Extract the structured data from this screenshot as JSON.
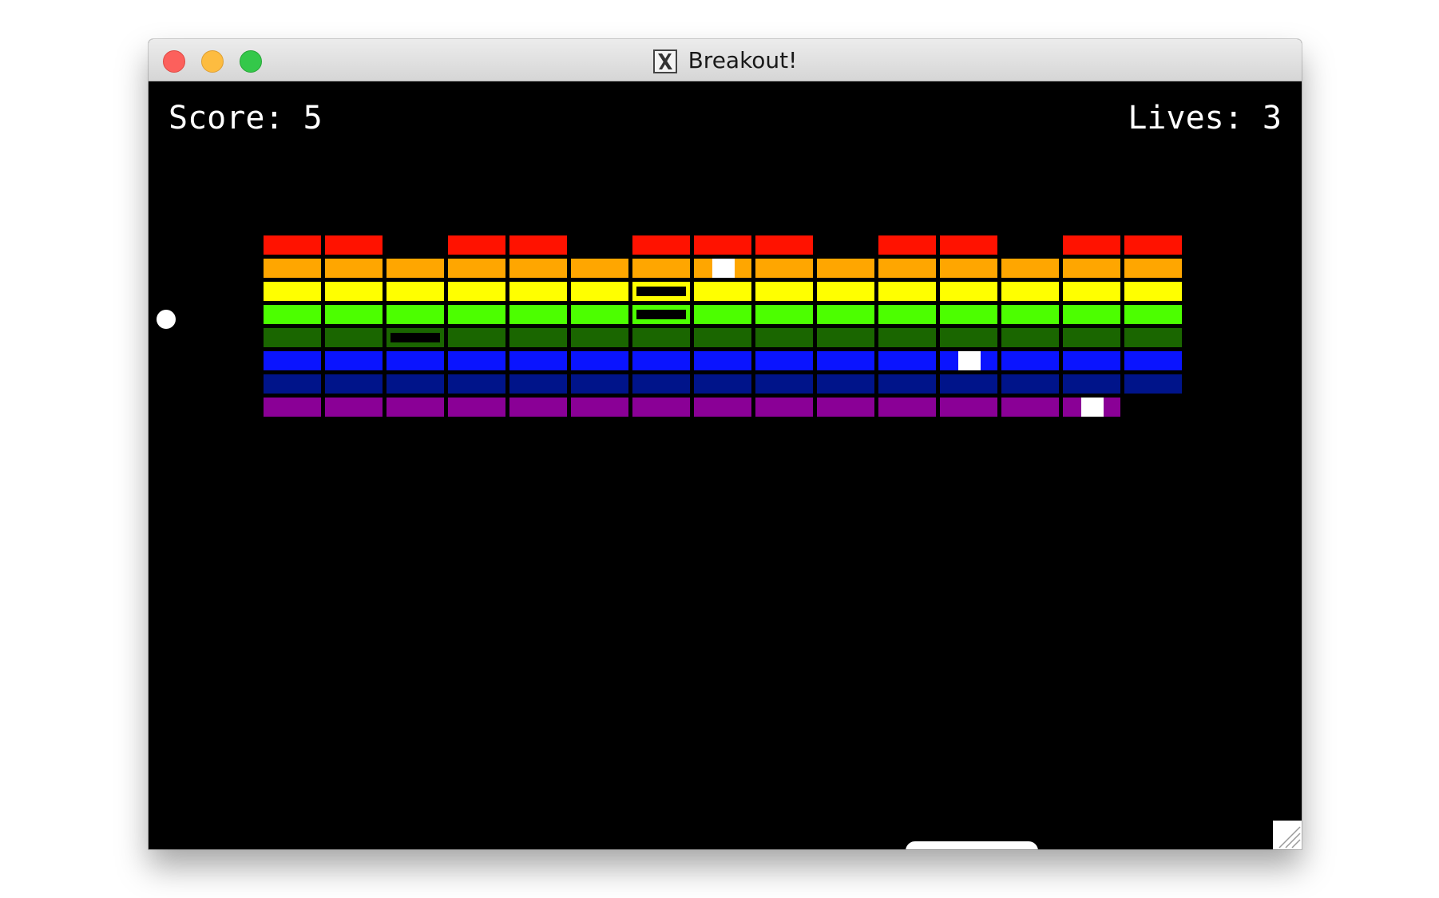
{
  "window": {
    "title": "Breakout!",
    "controls": [
      "close-button",
      "minimize-button",
      "maximize-button"
    ],
    "app_icon": "x11-icon"
  },
  "hud": {
    "score_label": "Score: 5",
    "lives_label": "Lives: 3"
  },
  "colors": {
    "background": "#000000",
    "rows": [
      "#ff1200",
      "#ffa600",
      "#ffff00",
      "#4cff00",
      "#1a6600",
      "#0a14ff",
      "#00148a",
      "#8a0096"
    ],
    "ball": "#ffffff",
    "paddle": "#ffffff"
  },
  "bricks": {
    "columns": 15,
    "rows": 8,
    "missing": [
      [
        0,
        2
      ],
      [
        0,
        5
      ],
      [
        0,
        9
      ],
      [
        0,
        12
      ],
      [
        7,
        14
      ]
    ],
    "hollow": [
      [
        2,
        6
      ],
      [
        3,
        6
      ],
      [
        4,
        2
      ]
    ],
    "marked": [
      [
        1,
        7
      ],
      [
        5,
        11
      ],
      [
        7,
        13
      ]
    ]
  },
  "ball": {
    "shape": "circle"
  },
  "paddle": {
    "shape": "rounded-bar"
  }
}
